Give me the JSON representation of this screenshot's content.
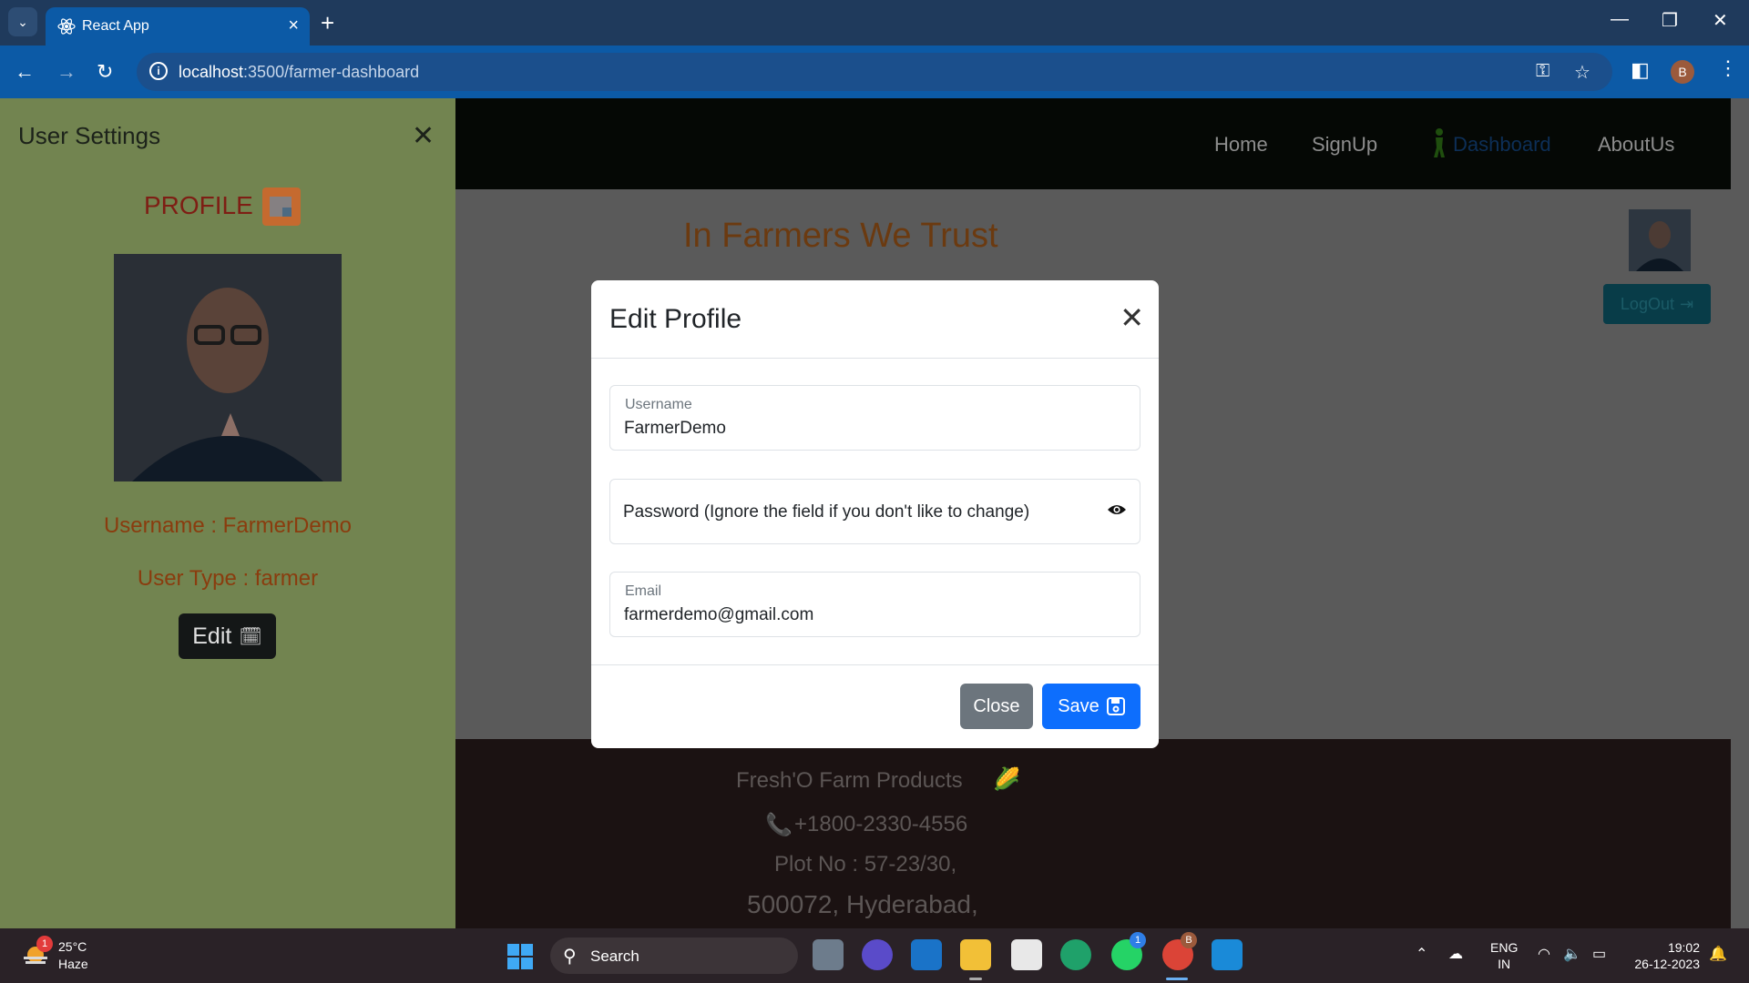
{
  "browser": {
    "tab_title": "React App",
    "url_host": "localhost",
    "url_rest": ":3500/farmer-dashboard",
    "profile_initial": "B"
  },
  "header": {
    "nav": [
      "Home",
      "SignUp",
      "Dashboard",
      "AboutUs"
    ]
  },
  "main": {
    "slogan": "In Farmers We Trust",
    "logout_label": "LogOut"
  },
  "footer": {
    "brand": "Fresh'O Farm Products",
    "phone": "+1800-2330-4556",
    "address1": "Plot No : 57-23/30,",
    "address2": "500072, Hyderabad,"
  },
  "sidebar": {
    "title": "User Settings",
    "profile_heading": "PROFILE",
    "username_line": "Username : FarmerDemo",
    "usertype_line": "User Type : farmer",
    "edit_label": "Edit"
  },
  "modal": {
    "title": "Edit Profile",
    "username_label": "Username",
    "username_value": "FarmerDemo",
    "password_placeholder": "Password (Ignore the field if you don't like to change)",
    "email_label": "Email",
    "email_value": "farmerdemo@gmail.com",
    "close_label": "Close",
    "save_label": "Save"
  },
  "taskbar": {
    "temp": "25°C",
    "weather": "Haze",
    "weather_badge": "1",
    "search_label": "Search",
    "lang1": "ENG",
    "lang2": "IN",
    "time": "19:02",
    "date": "26-12-2023",
    "whatsapp_badge": "1",
    "chrome_badge": "B"
  },
  "colors": {
    "browser_tab_active": "#0c5aa6",
    "sidebar_bg": "#728450",
    "primary": "#0d6efd",
    "secondary": "#6c757d"
  }
}
